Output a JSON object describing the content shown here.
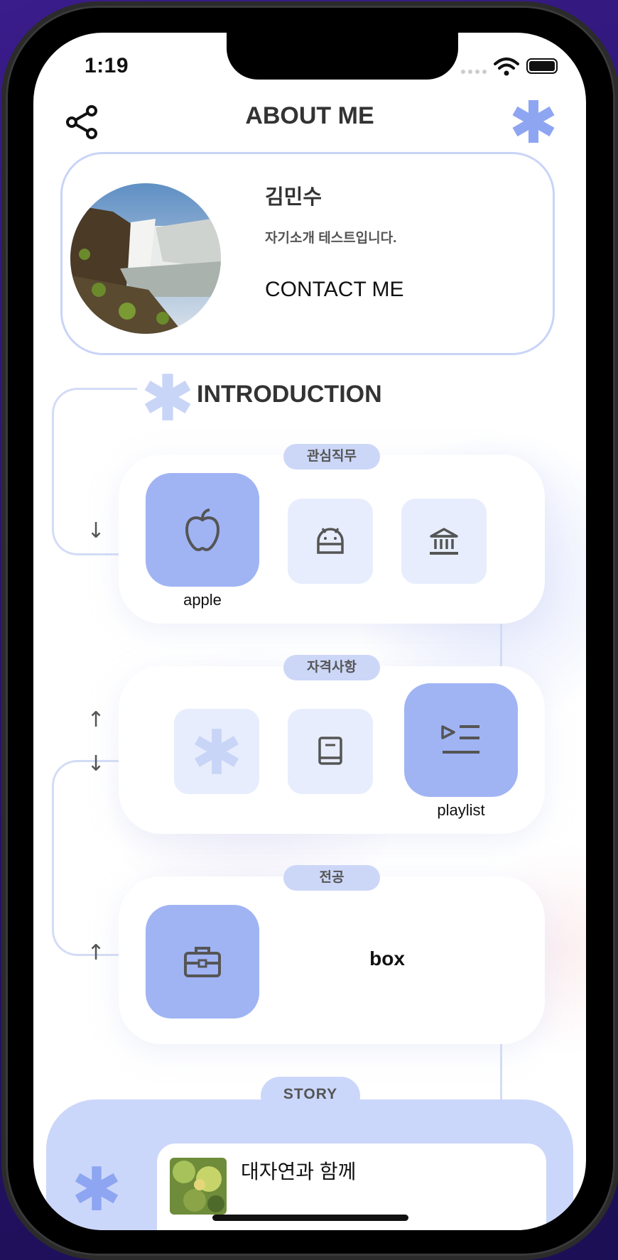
{
  "status_bar": {
    "time": "1:19"
  },
  "header": {
    "title": "ABOUT ME",
    "share_icon": "share-icon",
    "asterisk_icon": "asterisk-icon"
  },
  "profile": {
    "name": "김민수",
    "bio": "자기소개 테스트입니다.",
    "contact_label": "CONTACT ME"
  },
  "introduction": {
    "title": "INTRODUCTION",
    "sections": [
      {
        "label": "관심직무",
        "items": [
          {
            "icon": "apple-icon",
            "label": "apple",
            "selected": true
          },
          {
            "icon": "android-icon",
            "selected": false
          },
          {
            "icon": "bank-icon",
            "selected": false
          }
        ]
      },
      {
        "label": "자격사항",
        "items": [
          {
            "icon": "asterisk-icon",
            "selected": false
          },
          {
            "icon": "book-icon",
            "selected": false
          },
          {
            "icon": "playlist-icon",
            "label": "playlist",
            "selected": true
          }
        ]
      },
      {
        "label": "전공",
        "items": [
          {
            "icon": "briefcase-icon",
            "label": "box",
            "selected": true
          }
        ]
      }
    ]
  },
  "story": {
    "label": "STORY",
    "items": [
      {
        "title": "대자연과 함께"
      }
    ]
  },
  "colors": {
    "accent": "#8ea5f2",
    "tile_selected": "#a0b4f4",
    "tile_unselected": "#e7edfc",
    "pill": "#ccd7f8",
    "border": "#c9d4f7"
  }
}
